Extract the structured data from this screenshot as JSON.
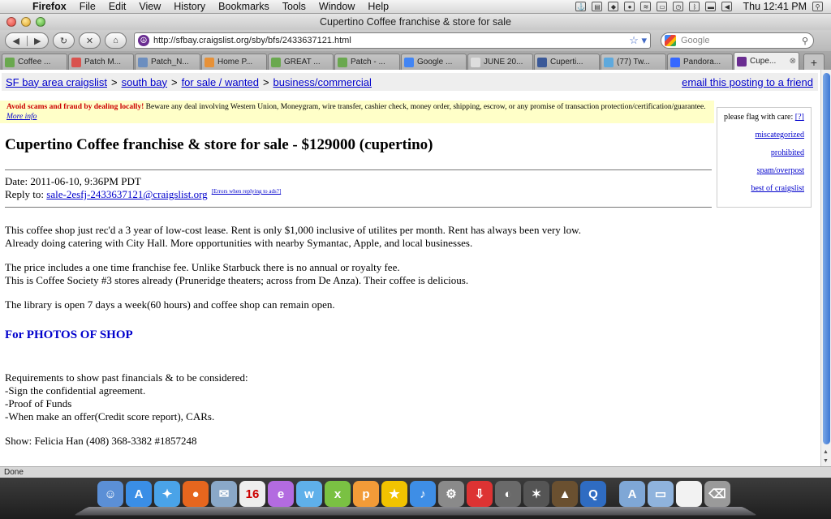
{
  "menubar": {
    "app": "Firefox",
    "items": [
      "File",
      "Edit",
      "View",
      "History",
      "Bookmarks",
      "Tools",
      "Window",
      "Help"
    ],
    "clock": "Thu 12:41 PM"
  },
  "window": {
    "title": "Cupertino Coffee franchise & store for sale"
  },
  "navbar": {
    "url": "http://sfbay.craigslist.org/sby/bfs/2433637121.html",
    "search_placeholder": "Google"
  },
  "tabs": [
    {
      "label": "Coffee ...",
      "color": "#6aa84f"
    },
    {
      "label": "Patch M...",
      "color": "#d9534f"
    },
    {
      "label": "Patch_N...",
      "color": "#6c8ebf"
    },
    {
      "label": "Home P...",
      "color": "#e69138"
    },
    {
      "label": "GREAT ...",
      "color": "#6aa84f"
    },
    {
      "label": "Patch - ...",
      "color": "#6aa84f"
    },
    {
      "label": "Google ...",
      "color": "#4285f4"
    },
    {
      "label": "JUNE 20...",
      "color": "#dddddd"
    },
    {
      "label": "Cuperti...",
      "color": "#3b5998"
    },
    {
      "label": "(77) Tw...",
      "color": "#5ea9dd"
    },
    {
      "label": "Pandora...",
      "color": "#3668ff"
    },
    {
      "label": "Cupe...",
      "color": "#6a2d91",
      "active": true
    }
  ],
  "page": {
    "breadcrumb": [
      {
        "label": "SF bay area craigslist"
      },
      {
        "label": "south bay"
      },
      {
        "label": "for sale / wanted"
      },
      {
        "label": "business/commercial"
      }
    ],
    "email_link": "email this posting to a friend",
    "warning": {
      "strong": "Avoid scams and fraud by dealing locally!",
      "text": " Beware any deal involving Western Union, Moneygram, wire transfer, cashier check, money order, shipping, escrow, or any promise of transaction protection/certification/guarantee. ",
      "more": "More info"
    },
    "flag": {
      "heading": "please flag with care: ",
      "help": "[?]",
      "items": [
        "miscategorized",
        "prohibited",
        "spam/overpost",
        "best of craigslist"
      ]
    },
    "title": "Cupertino Coffee franchise & store for sale - $129000 (cupertino)",
    "date": "Date: 2011-06-10, 9:36PM PDT",
    "reply_label": "Reply to: ",
    "reply_email": "sale-2esfj-2433637121@craigslist.org",
    "reply_errors": "[Errors when replying to ads?]",
    "body": {
      "p1a": "This coffee shop just rec'd a 3 year of low-cost lease. Rent is only $1,000 inclusive of utilites per month. Rent has always been very low.",
      "p1b": "Already doing catering with City Hall. More opportunities with nearby Symantac, Apple, and local businesses.",
      "p2a": "The price includes a one time franchise fee. Unlike Starbuck there is no annual or royalty fee.",
      "p2b": "This is Coffee Society #3 stores already (Pruneridge theaters; across from De Anza). Their coffee is delicious.",
      "p3": "The library is open 7 days a week(60 hours) and coffee shop can remain open.",
      "photos": "For PHOTOS OF SHOP",
      "req_head": "Requirements to show past financials & to be considered:",
      "req1": "-Sign the confidential agreement.",
      "req2": "-Proof of Funds",
      "req3": "-When make an offer(Credit score report), CARs.",
      "show": "Show: Felicia Han (408) 368-3382 #1857248"
    }
  },
  "status": "Done",
  "dock": [
    {
      "name": "finder-icon",
      "color": "#5b8fd6",
      "glyph": "☺"
    },
    {
      "name": "app-store-icon",
      "color": "#3a8ee6",
      "glyph": "A"
    },
    {
      "name": "safari-icon",
      "color": "#4aa3e8",
      "glyph": "✦"
    },
    {
      "name": "firefox-icon",
      "color": "#e6661e",
      "glyph": "●"
    },
    {
      "name": "mail-icon",
      "color": "#8aa8c8",
      "glyph": "✉"
    },
    {
      "name": "calendar-icon",
      "color": "#eeeeee",
      "glyph": "16"
    },
    {
      "name": "app-purple-icon",
      "color": "#b36be0",
      "glyph": "e"
    },
    {
      "name": "app-blue-icon",
      "color": "#5fb0ea",
      "glyph": "w"
    },
    {
      "name": "app-green-icon",
      "color": "#7ac143",
      "glyph": "x"
    },
    {
      "name": "app-orange-icon",
      "color": "#f29b38",
      "glyph": "p"
    },
    {
      "name": "aim-icon",
      "color": "#f2c300",
      "glyph": "★"
    },
    {
      "name": "itunes-icon",
      "color": "#3e8ee6",
      "glyph": "♪"
    },
    {
      "name": "preferences-icon",
      "color": "#8a8a8a",
      "glyph": "⚙"
    },
    {
      "name": "download-icon",
      "color": "#d33",
      "glyph": "⇩"
    },
    {
      "name": "photo-icon",
      "color": "#6a6a6a",
      "glyph": "◐"
    },
    {
      "name": "imovie-icon",
      "color": "#555555",
      "glyph": "✶"
    },
    {
      "name": "iphoto-icon",
      "color": "#6a5030",
      "glyph": "▲"
    },
    {
      "name": "quicktime-icon",
      "color": "#2f6cc2",
      "glyph": "Q"
    },
    {
      "name": "applications-folder-icon",
      "color": "#7fa7d6",
      "glyph": "A"
    },
    {
      "name": "documents-folder-icon",
      "color": "#8fb3dd",
      "glyph": "▭"
    },
    {
      "name": "document-icon",
      "color": "#f2f2f2",
      "glyph": ""
    },
    {
      "name": "trash-icon",
      "color": "#9a9a9a",
      "glyph": "⌫"
    }
  ]
}
